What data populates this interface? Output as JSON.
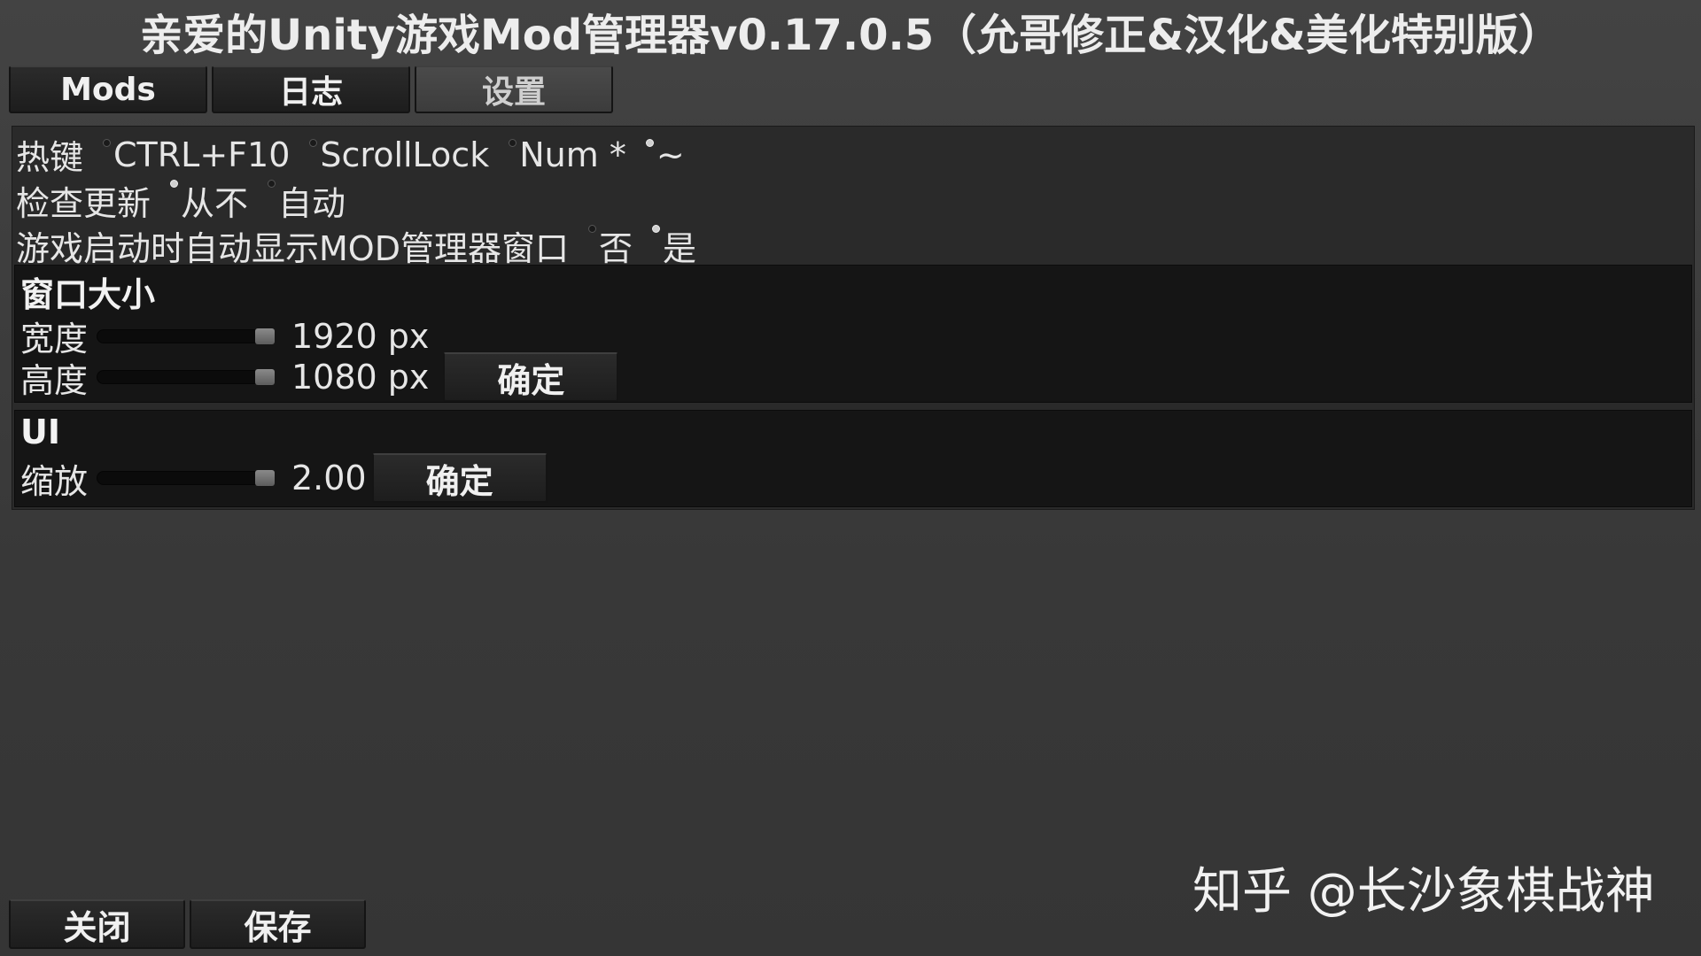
{
  "window": {
    "title": "亲爱的Unity游戏Mod管理器v0.17.0.5（允哥修正&汉化&美化特别版）"
  },
  "tabs": [
    {
      "label": "Mods",
      "active": false
    },
    {
      "label": "日志",
      "active": false
    },
    {
      "label": "设置",
      "active": true
    }
  ],
  "settings": {
    "hotkey": {
      "label": "热键",
      "options": [
        "CTRL+F10",
        "ScrollLock",
        "Num *",
        "~"
      ],
      "selected": "~"
    },
    "check_updates": {
      "label": "检查更新",
      "options": [
        "从不",
        "自动"
      ],
      "selected": "从不"
    },
    "show_on_start": {
      "label": "游戏启动时自动显示MOD管理器窗口",
      "options": [
        "否",
        "是"
      ],
      "selected": "是"
    }
  },
  "window_size": {
    "title": "窗口大小",
    "width_label": "宽度",
    "width_value": "1920 px",
    "width_fraction": 1.0,
    "height_label": "高度",
    "height_value": "1080 px",
    "height_fraction": 1.0,
    "confirm_label": "确定"
  },
  "ui": {
    "title": "UI",
    "scale_label": "缩放",
    "scale_value": "2.00",
    "scale_fraction": 1.0,
    "confirm_label": "确定"
  },
  "footer": {
    "close_label": "关闭",
    "save_label": "保存"
  },
  "watermark": {
    "text": "知乎 @长沙象棋战神"
  },
  "colors": {
    "background": "#3a3a3a",
    "panel": "#2a2a2a",
    "group": "#151515",
    "button": "#1d1d1d",
    "text": "#e6e6e6"
  }
}
